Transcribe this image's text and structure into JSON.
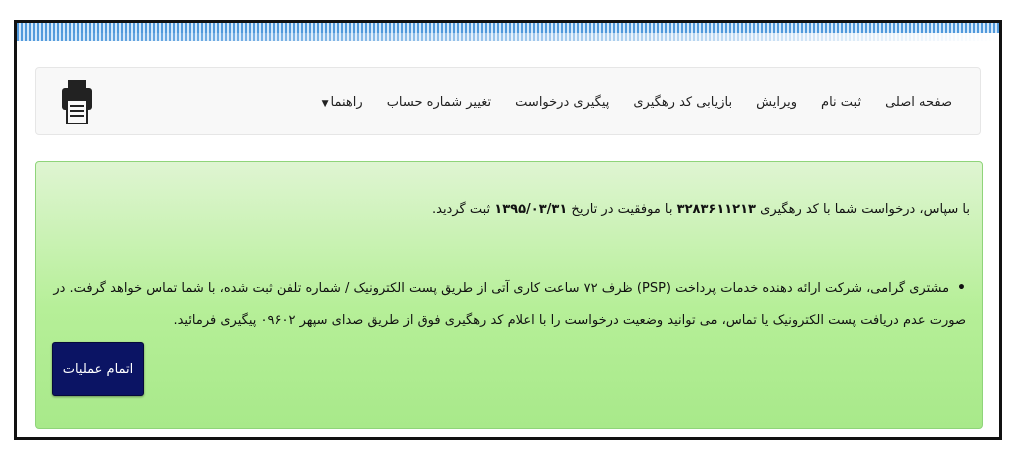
{
  "nav": {
    "items": [
      {
        "label": "صفحه اصلی"
      },
      {
        "label": "ثبت نام"
      },
      {
        "label": "ویرایش"
      },
      {
        "label": "بازیابی کد رهگیری"
      },
      {
        "label": "پیگیری درخواست"
      },
      {
        "label": "تغییر شماره حساب"
      },
      {
        "label": "راهنما"
      }
    ],
    "print_icon": "printer-icon"
  },
  "alert": {
    "line1_prefix": "با سپاس، درخواست شما با کد رهگیری",
    "tracking_code": "۳۲۸۳۶۱۱۲۱۳",
    "line1_mid": "با موفقیت در تاریخ",
    "date": "۱۳۹۵/۰۳/۳۱",
    "line1_suffix": "ثبت گردید.",
    "bullet_text": "مشتری گرامی، شرکت ارائه دهنده خدمات پرداخت (PSP) ظرف ۷۲ ساعت کاری آتی از طریق پست الکترونیک / شماره تلفن ثبت شده، با شما تماس خواهد گرفت. در صورت عدم دریافت پست الکترونیک یا تماس، می توانید وضعیت درخواست را با اعلام کد رهگیری فوق از طریق صدای سپهر ۰۹۶۰۲ پیگیری فرمائید.",
    "finish_button": "اتمام عملیات"
  },
  "colors": {
    "alert_bg": "#b6ef98",
    "button_bg": "#0b1464",
    "stripe": "#3f8fd8"
  }
}
